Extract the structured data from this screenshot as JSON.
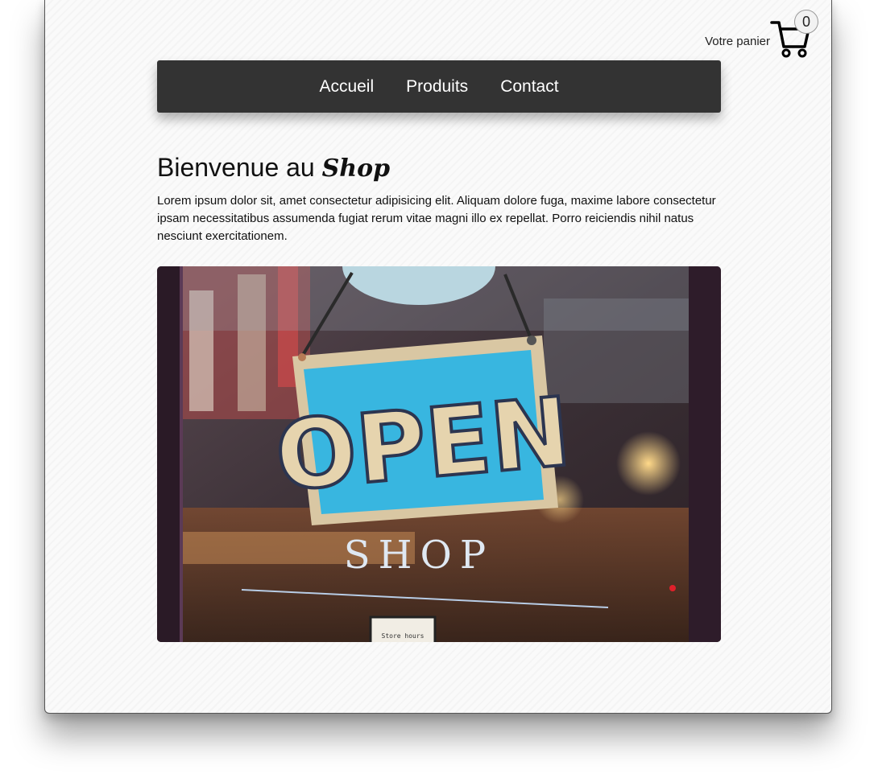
{
  "cart": {
    "label": "Votre panier",
    "count": "0",
    "icon": "shopping-cart-icon"
  },
  "nav": {
    "items": [
      {
        "label": "Accueil"
      },
      {
        "label": "Produits"
      },
      {
        "label": "Contact"
      }
    ],
    "background": "#333333"
  },
  "main": {
    "title_prefix": "Bienvenue au",
    "title_brand": "Shop",
    "intro": "Lorem ipsum dolor sit, amet consectetur adipisicing elit. Aliquam dolore fuga, maxime labore consectetur ipsam necessitatibus assumenda fugiat rerum vitae magni illo ex repellat. Porro reiciendis nihil natus nesciunt exercitationem."
  },
  "hero": {
    "sign_text": "OPEN",
    "window_text": "SHOP",
    "card_text": "Store hours",
    "sign_color": "#38b6e0"
  }
}
